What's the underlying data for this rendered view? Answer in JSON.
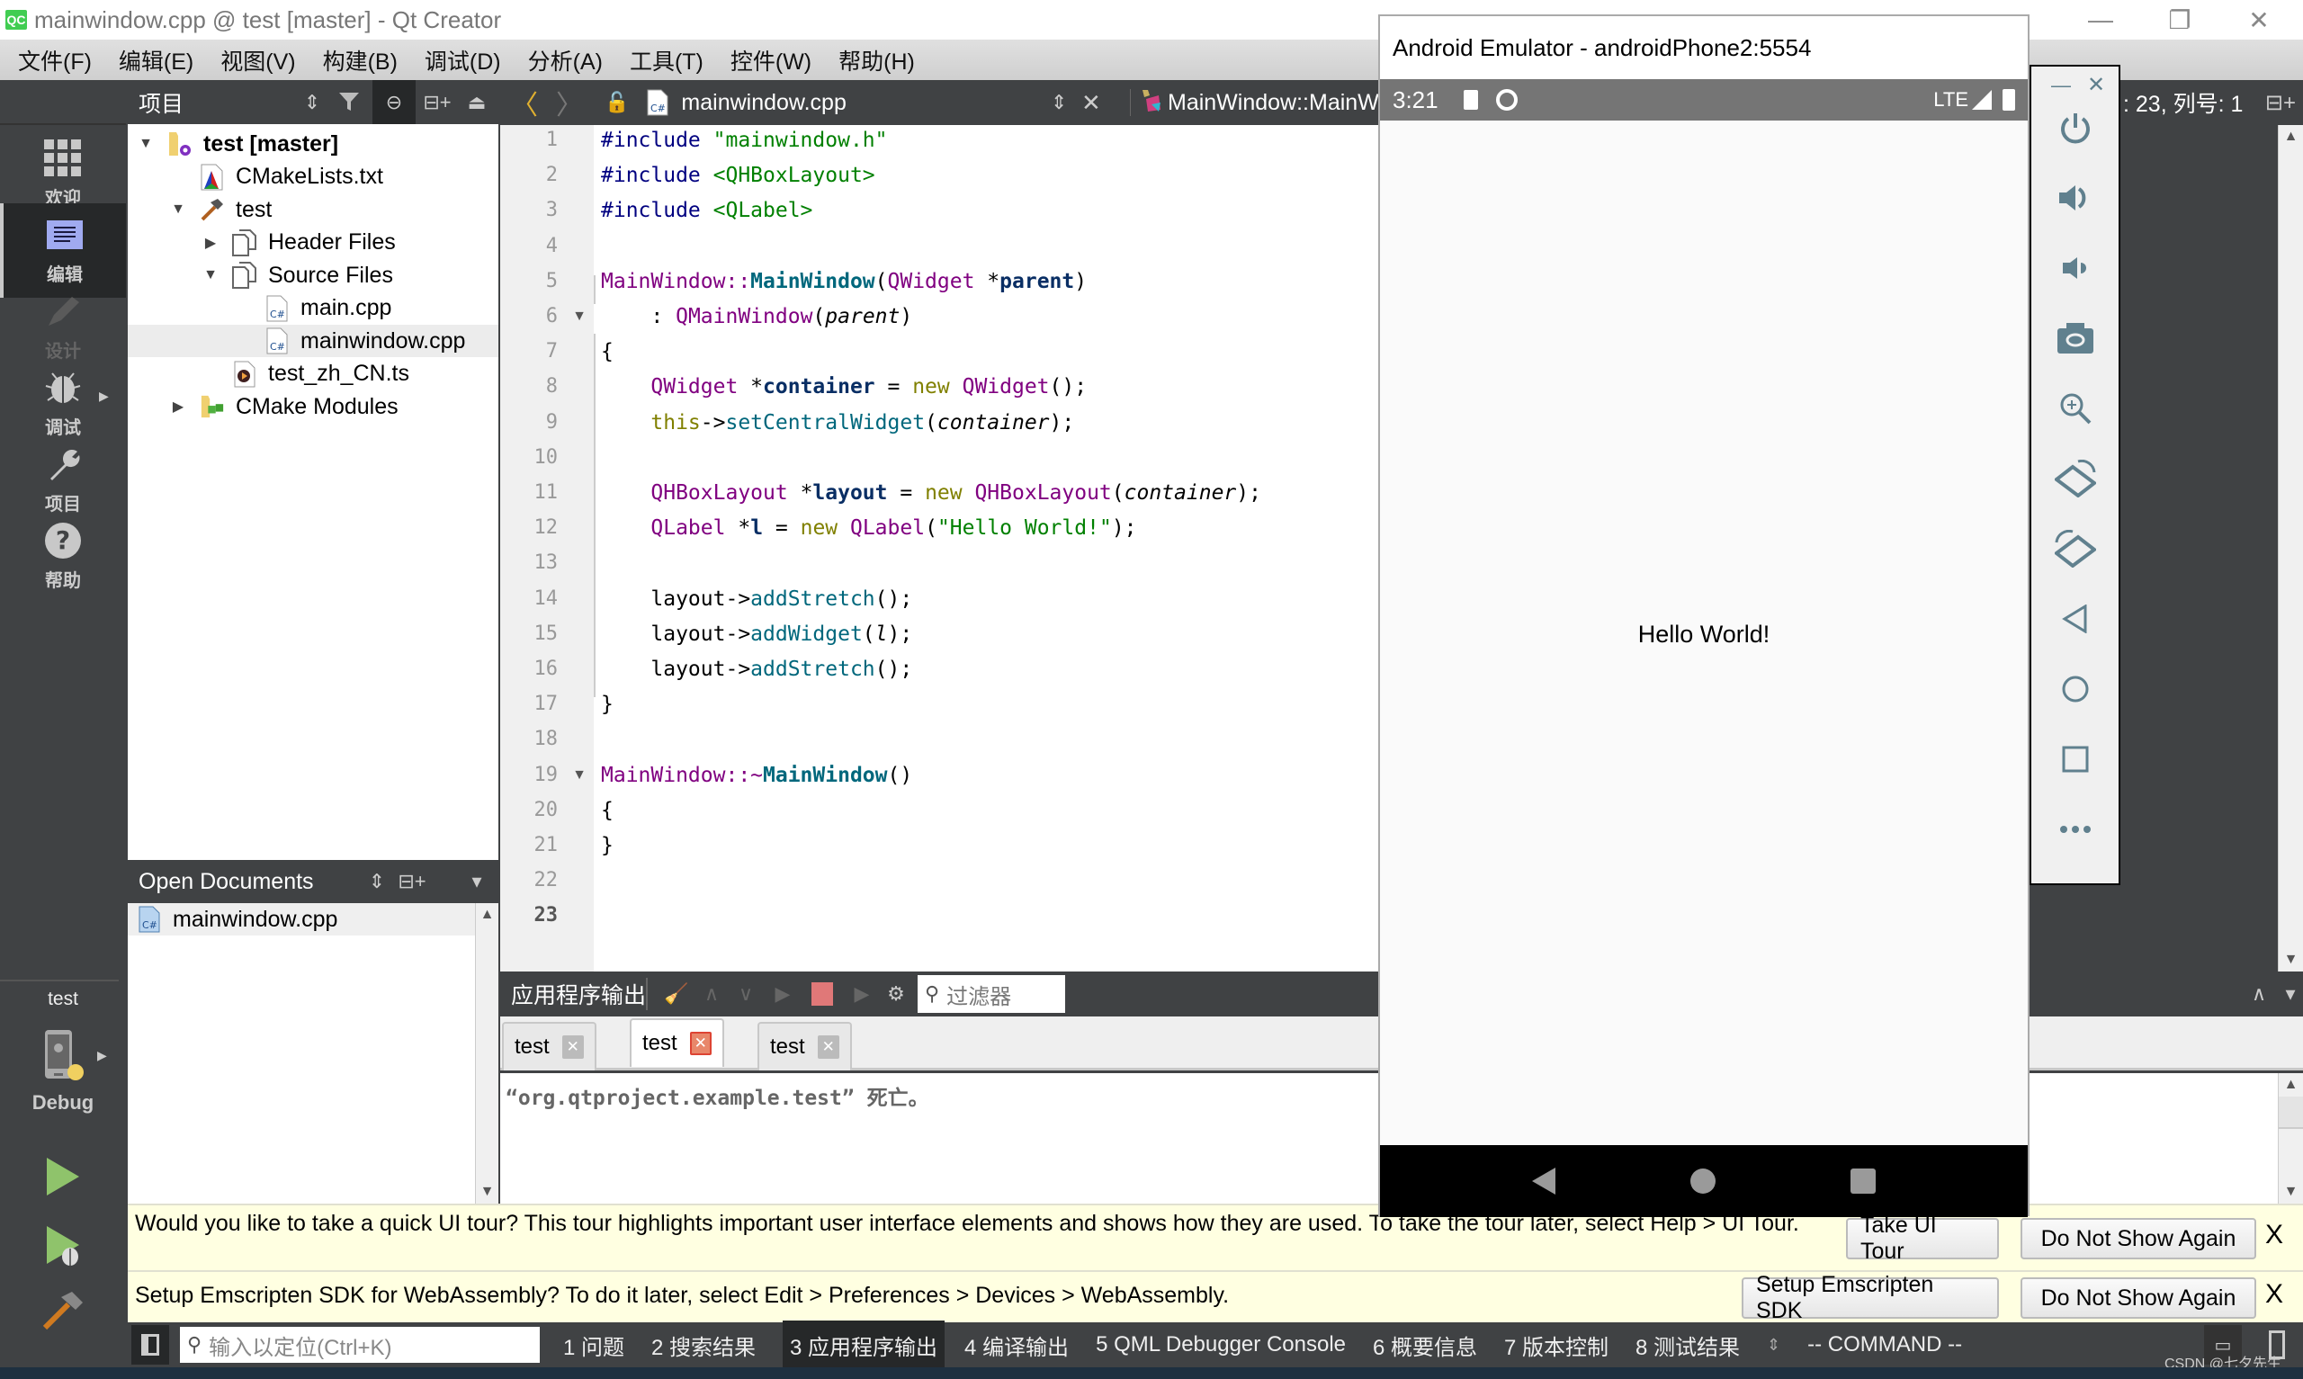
{
  "window": {
    "title": "mainwindow.cpp @ test [master] - Qt Creator",
    "app_icon": "qt-creator-icon",
    "app_icon_text": "QC",
    "controls": [
      "minimize",
      "restore",
      "close"
    ]
  },
  "menu": [
    "文件(F)",
    "编辑(E)",
    "视图(V)",
    "构建(B)",
    "调试(D)",
    "分析(A)",
    "工具(T)",
    "控件(W)",
    "帮助(H)"
  ],
  "modes": [
    {
      "label": "欢迎",
      "icon": "grid-icon",
      "state": "normal"
    },
    {
      "label": "编辑",
      "icon": "edit-doc-icon",
      "state": "active"
    },
    {
      "label": "设计",
      "icon": "pencil-icon",
      "state": "disabled"
    },
    {
      "label": "调试",
      "icon": "bug-icon",
      "state": "normal"
    },
    {
      "label": "项目",
      "icon": "wrench-icon",
      "state": "normal"
    },
    {
      "label": "帮助",
      "icon": "help-icon",
      "state": "normal"
    }
  ],
  "kit": {
    "project": "test",
    "build": "Debug",
    "device_icon": "android-device-icon"
  },
  "run_buttons": [
    "run",
    "debug-run",
    "build"
  ],
  "project_panel": {
    "title": "项目",
    "tree": [
      {
        "label": "test [master]",
        "depth": 0,
        "expand": "open",
        "icon": "project-folder-icon",
        "bold": true
      },
      {
        "label": "CMakeLists.txt",
        "depth": 1,
        "expand": "none",
        "icon": "cmake-file-icon"
      },
      {
        "label": "test",
        "depth": 1,
        "expand": "open",
        "icon": "hammer-icon"
      },
      {
        "label": "Header Files",
        "depth": 2,
        "expand": "closed",
        "icon": "files-icon"
      },
      {
        "label": "Source Files",
        "depth": 2,
        "expand": "open",
        "icon": "files-icon"
      },
      {
        "label": "main.cpp",
        "depth": 3,
        "expand": "none",
        "icon": "cpp-file-icon"
      },
      {
        "label": "mainwindow.cpp",
        "depth": 3,
        "expand": "none",
        "icon": "cpp-file-icon",
        "selected": true
      },
      {
        "label": "test_zh_CN.ts",
        "depth": 2,
        "expand": "none",
        "icon": "ts-file-icon"
      },
      {
        "label": "CMake Modules",
        "depth": 1,
        "expand": "closed",
        "icon": "cmake-modules-icon"
      }
    ]
  },
  "open_documents": {
    "title": "Open Documents",
    "items": [
      "mainwindow.cpp"
    ]
  },
  "editor": {
    "file": "mainwindow.cpp",
    "symbol": "MainWindow::MainW",
    "cursor": ": 23, 列号: 1",
    "current_line": 23,
    "fold_lines": [
      6,
      19
    ],
    "lines": [
      [
        [
          "pp",
          "#include "
        ],
        [
          "str",
          "\"mainwindow.h\""
        ]
      ],
      [
        [
          "pp",
          "#include "
        ],
        [
          "str",
          "<QHBoxLayout>"
        ]
      ],
      [
        [
          "pp",
          "#include "
        ],
        [
          "str",
          "<QLabel>"
        ]
      ],
      [],
      [
        [
          "cls",
          "MainWindow::"
        ],
        [
          "fn bold",
          "MainWindow"
        ],
        [
          "mem",
          "("
        ],
        [
          "cls",
          "QWidget "
        ],
        [
          "mem",
          "*"
        ],
        [
          "var",
          "parent"
        ],
        [
          "mem",
          ")"
        ]
      ],
      [
        [
          "mem",
          "    : "
        ],
        [
          "cls",
          "QMainWindow"
        ],
        [
          "mem",
          "("
        ],
        [
          "it",
          "parent"
        ],
        [
          "mem",
          ")"
        ]
      ],
      [
        [
          "mem",
          "{"
        ]
      ],
      [
        [
          "cls",
          "    QWidget "
        ],
        [
          "mem",
          "*"
        ],
        [
          "var",
          "container"
        ],
        [
          "mem",
          " = "
        ],
        [
          "kw",
          "new "
        ],
        [
          "cls",
          "QWidget"
        ],
        [
          "mem",
          "();"
        ]
      ],
      [
        [
          "kw",
          "    this"
        ],
        [
          "mem",
          "->"
        ],
        [
          "fn",
          "setCentralWidget"
        ],
        [
          "mem",
          "("
        ],
        [
          "it",
          "container"
        ],
        [
          "mem",
          ");"
        ]
      ],
      [],
      [
        [
          "cls",
          "    QHBoxLayout "
        ],
        [
          "mem",
          "*"
        ],
        [
          "var",
          "layout"
        ],
        [
          "mem",
          " = "
        ],
        [
          "kw",
          "new "
        ],
        [
          "cls",
          "QHBoxLayout"
        ],
        [
          "mem",
          "("
        ],
        [
          "it",
          "container"
        ],
        [
          "mem",
          ");"
        ]
      ],
      [
        [
          "cls",
          "    QLabel "
        ],
        [
          "mem",
          "*"
        ],
        [
          "var",
          "l"
        ],
        [
          "mem",
          " = "
        ],
        [
          "kw",
          "new "
        ],
        [
          "cls",
          "QLabel"
        ],
        [
          "mem",
          "("
        ],
        [
          "str",
          "\"Hello World!\""
        ],
        [
          "mem",
          ");"
        ]
      ],
      [],
      [
        [
          "mem",
          "    layout->"
        ],
        [
          "fn",
          "addStretch"
        ],
        [
          "mem",
          "();"
        ]
      ],
      [
        [
          "mem",
          "    layout->"
        ],
        [
          "fn",
          "addWidget"
        ],
        [
          "mem",
          "("
        ],
        [
          "it",
          "l"
        ],
        [
          "mem",
          ");"
        ]
      ],
      [
        [
          "mem",
          "    layout->"
        ],
        [
          "fn",
          "addStretch"
        ],
        [
          "mem",
          "();"
        ]
      ],
      [
        [
          "mem",
          "}"
        ]
      ],
      [],
      [
        [
          "cls",
          "MainWindow::~"
        ],
        [
          "fn bold",
          "MainWindow"
        ],
        [
          "mem",
          "()"
        ]
      ],
      [
        [
          "mem",
          "{"
        ]
      ],
      [
        [
          "mem",
          "}"
        ]
      ],
      [],
      []
    ]
  },
  "output": {
    "title": "应用程序输出",
    "filter_placeholder": "过滤器",
    "tabs": [
      {
        "label": "test",
        "active": false
      },
      {
        "label": "test",
        "active": true
      },
      {
        "label": "test",
        "active": false
      }
    ],
    "text": "“org.qtproject.example.test” 死亡。"
  },
  "infobars": [
    {
      "text": "Would you like to take a quick UI tour? This tour highlights important user interface elements and shows how they are used. To take the tour later, select Help > UI Tour.",
      "buttons": [
        "Take UI Tour",
        "Do Not Show Again"
      ],
      "close": "X"
    },
    {
      "text": "Setup Emscripten SDK for WebAssembly? To do it later, select Edit > Preferences > Devices > WebAssembly.",
      "buttons": [
        "Setup Emscripten SDK",
        "Do Not Show Again"
      ],
      "close": "X"
    }
  ],
  "statusbar": {
    "locator_placeholder": "输入以定位(Ctrl+K)",
    "tabs": [
      {
        "label": "1  问题"
      },
      {
        "label": "2  搜索结果"
      },
      {
        "label": "3  应用程序输出",
        "active": true
      },
      {
        "label": "4  编译输出"
      },
      {
        "label": "5  QML Debugger Console"
      },
      {
        "label": "6  概要信息"
      },
      {
        "label": "7  版本控制"
      },
      {
        "label": "8  测试结果"
      }
    ],
    "mode": "-- COMMAND --",
    "watermark": "CSDN @七夕先生"
  },
  "emulator": {
    "title": "Android Emulator - androidPhone2:5554",
    "time": "3:21",
    "network": "LTE",
    "app_text": "Hello World!",
    "tools": [
      "power-icon",
      "volume-up-icon",
      "volume-down-icon",
      "camera-icon",
      "zoom-in-icon",
      "rotate-left-icon",
      "rotate-right-icon",
      "back-icon",
      "home-icon",
      "overview-icon",
      "more-icon"
    ],
    "tool_window_controls": [
      "minimize",
      "close"
    ]
  }
}
